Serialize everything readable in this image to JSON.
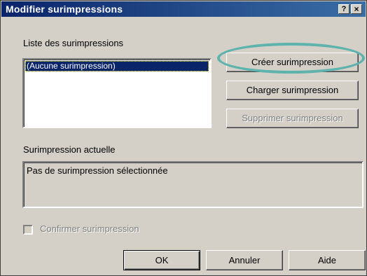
{
  "window": {
    "title": "Modifier surimpressions",
    "help_glyph": "?",
    "close_glyph": "×"
  },
  "overlay_list": {
    "label": "Liste des surimpressions",
    "items": [
      "(Aucune surimpression)"
    ],
    "selected_index": 0
  },
  "buttons": {
    "create": "Créer surimpression",
    "load": "Charger surimpression",
    "delete": "Supprimer surimpression",
    "ok": "OK",
    "cancel": "Annuler",
    "help": "Aide"
  },
  "current_overlay": {
    "label": "Surimpression actuelle",
    "value": "Pas de surimpression sélectionnée"
  },
  "confirm": {
    "label": "Confirmer surimpression",
    "checked": false,
    "enabled": false
  },
  "colors": {
    "titlebar": "#0a246a",
    "face": "#d4d0c8",
    "highlight_ring": "#5fb3ad"
  }
}
